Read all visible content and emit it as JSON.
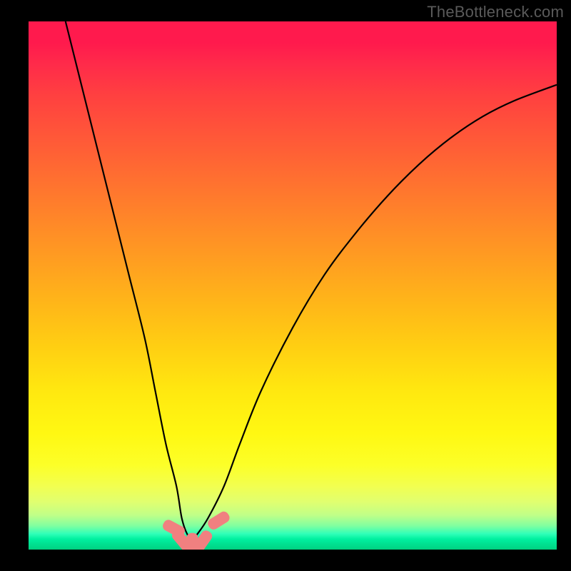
{
  "watermark": "TheBottleneck.com",
  "chart_data": {
    "type": "line",
    "title": "",
    "xlabel": "",
    "ylabel": "",
    "xlim": [
      0,
      100
    ],
    "ylim": [
      0,
      100
    ],
    "grid": false,
    "legend": false,
    "series": [
      {
        "name": "bottleneck-curve",
        "color": "#000000",
        "x": [
          7,
          10,
          13,
          16,
          19,
          22,
          24,
          26,
          28,
          29,
          30,
          31,
          32,
          34,
          37,
          40,
          44,
          50,
          56,
          62,
          68,
          74,
          80,
          86,
          92,
          100
        ],
        "y": [
          100,
          88,
          76,
          64,
          52,
          40,
          30,
          20,
          12,
          6,
          3,
          2,
          3,
          6,
          12,
          20,
          30,
          42,
          52,
          60,
          67,
          73,
          78,
          82,
          85,
          88
        ]
      }
    ],
    "markers": [
      {
        "name": "trough-marker",
        "color": "#f08080",
        "x": 27.5,
        "y": 4.0,
        "angle": -62
      },
      {
        "name": "trough-marker",
        "color": "#f08080",
        "x": 29.0,
        "y": 1.8,
        "angle": -40
      },
      {
        "name": "trough-marker",
        "color": "#f08080",
        "x": 31.0,
        "y": 1.0,
        "angle": 0
      },
      {
        "name": "trough-marker",
        "color": "#f08080",
        "x": 33.0,
        "y": 1.6,
        "angle": 35
      },
      {
        "name": "trough-marker",
        "color": "#f08080",
        "x": 36.0,
        "y": 5.5,
        "angle": 58
      }
    ]
  }
}
